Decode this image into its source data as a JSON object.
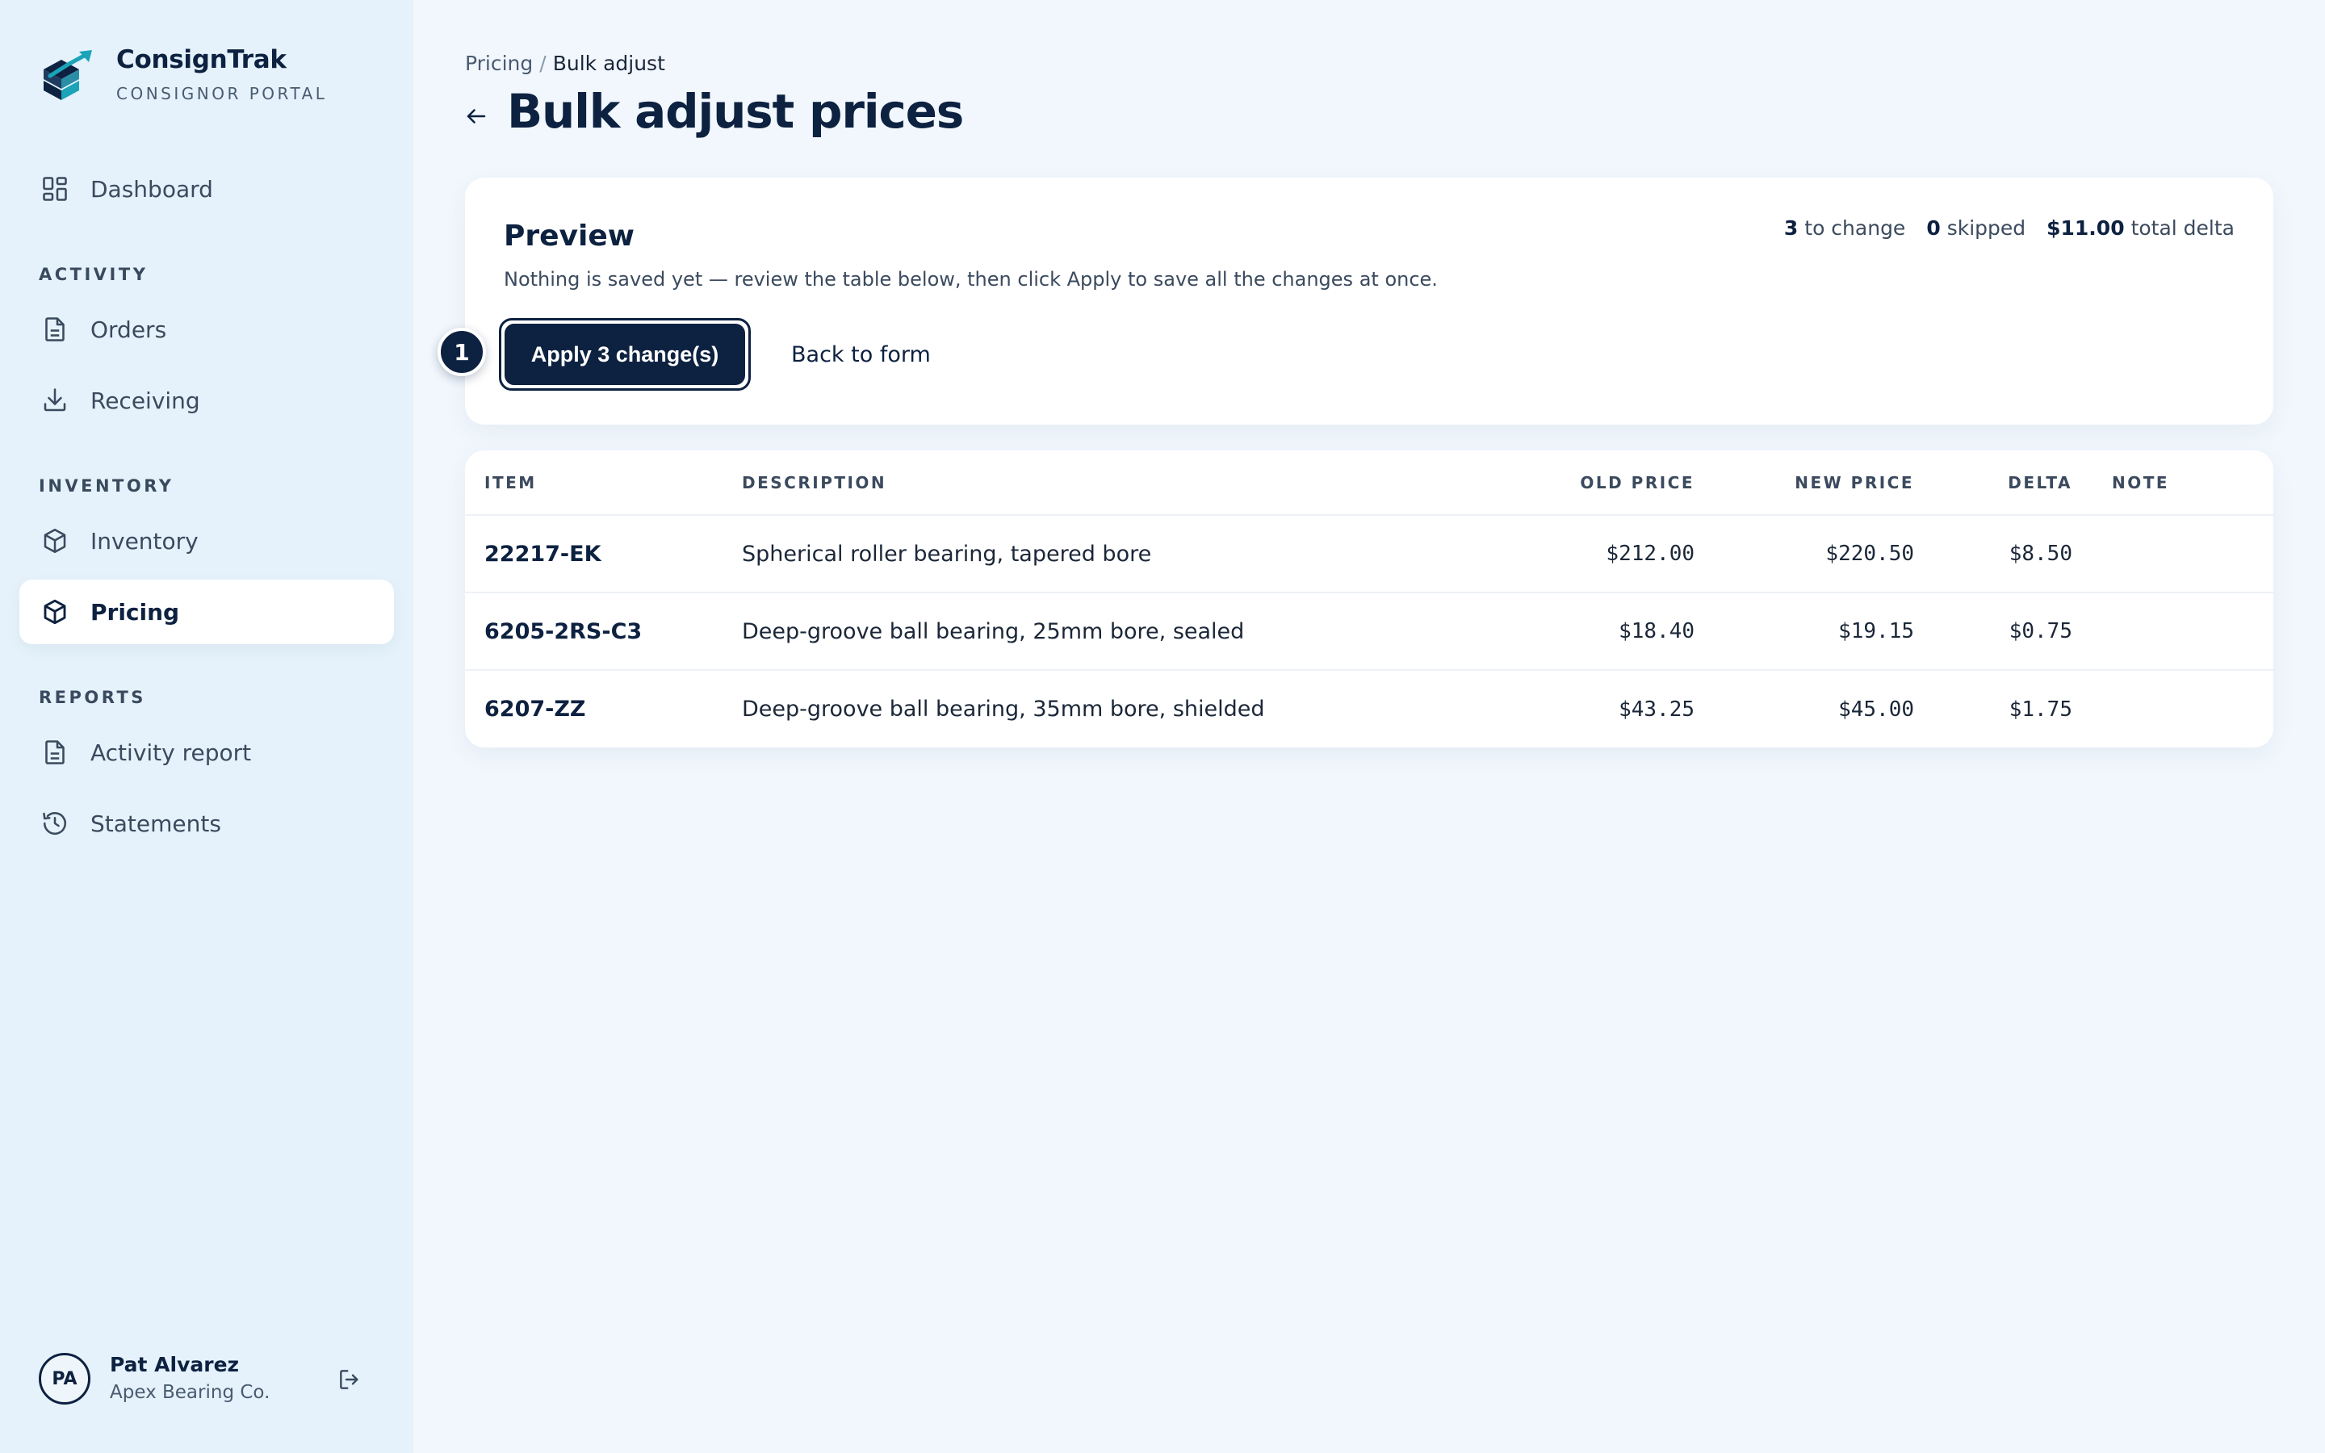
{
  "brand": {
    "name": "ConsignTrak",
    "subtitle": "CONSIGNOR PORTAL"
  },
  "sidebar": {
    "dashboard": "Dashboard",
    "sections": {
      "activity": "ACTIVITY",
      "inventory": "INVENTORY",
      "reports": "REPORTS"
    },
    "items": {
      "orders": "Orders",
      "receiving": "Receiving",
      "inventory": "Inventory",
      "pricing": "Pricing",
      "activity_report": "Activity report",
      "statements": "Statements"
    },
    "active_item": "Pricing"
  },
  "user": {
    "initials": "PA",
    "name": "Pat Alvarez",
    "org": "Apex Bearing Co."
  },
  "breadcrumb": {
    "parent": "Pricing",
    "separator": "/",
    "current": "Bulk adjust"
  },
  "page": {
    "title": "Bulk adjust prices"
  },
  "preview": {
    "title": "Preview",
    "description": "Nothing is saved yet — review the table below, then click Apply to save all the changes at once.",
    "stats": {
      "to_change_count": "3",
      "to_change_label": "to change",
      "skipped_count": "0",
      "skipped_label": "skipped",
      "total_delta_value": "$11.00",
      "total_delta_label": "total delta"
    },
    "step_badge": "1",
    "apply_label": "Apply 3 change(s)",
    "back_label": "Back to form"
  },
  "table": {
    "headers": {
      "item": "ITEM",
      "description": "DESCRIPTION",
      "old_price": "OLD PRICE",
      "new_price": "NEW PRICE",
      "delta": "DELTA",
      "note": "NOTE"
    },
    "rows": [
      {
        "item": "22217-EK",
        "description": "Spherical roller bearing, tapered bore",
        "old_price": "$212.00",
        "new_price": "$220.50",
        "delta": "$8.50",
        "note": ""
      },
      {
        "item": "6205-2RS-C3",
        "description": "Deep-groove ball bearing, 25mm bore, sealed",
        "old_price": "$18.40",
        "new_price": "$19.15",
        "delta": "$0.75",
        "note": ""
      },
      {
        "item": "6207-ZZ",
        "description": "Deep-groove ball bearing, 35mm bore, shielded",
        "old_price": "$43.25",
        "new_price": "$45.00",
        "delta": "$1.75",
        "note": ""
      }
    ]
  },
  "colors": {
    "navy": "#0d2140",
    "sidebar_bg": "#e5f2fb",
    "page_bg": "#f1f7fd",
    "logo_teal": "#1ba3b8"
  }
}
